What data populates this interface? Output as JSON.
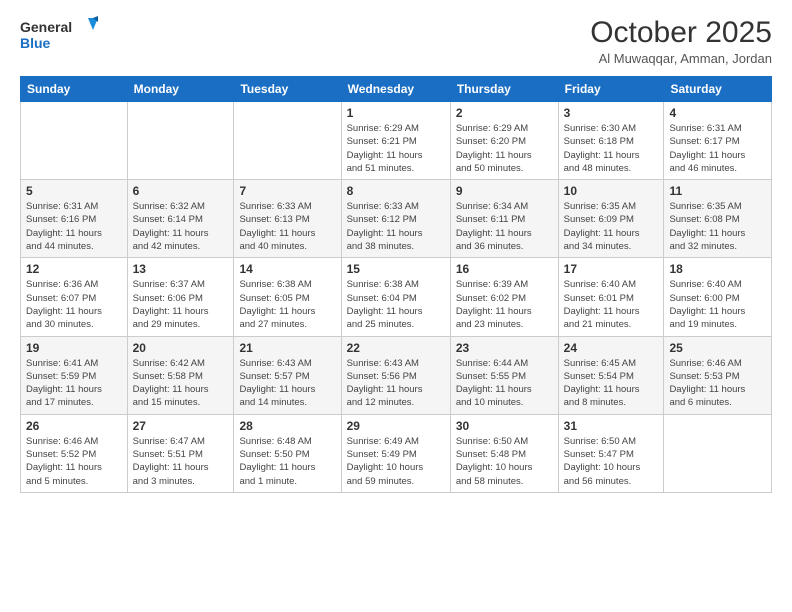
{
  "logo": {
    "line1": "General",
    "line2": "Blue"
  },
  "header": {
    "title": "October 2025",
    "subtitle": "Al Muwaqqar, Amman, Jordan"
  },
  "weekdays": [
    "Sunday",
    "Monday",
    "Tuesday",
    "Wednesday",
    "Thursday",
    "Friday",
    "Saturday"
  ],
  "weeks": [
    [
      {
        "day": "",
        "info": ""
      },
      {
        "day": "",
        "info": ""
      },
      {
        "day": "",
        "info": ""
      },
      {
        "day": "1",
        "info": "Sunrise: 6:29 AM\nSunset: 6:21 PM\nDaylight: 11 hours\nand 51 minutes."
      },
      {
        "day": "2",
        "info": "Sunrise: 6:29 AM\nSunset: 6:20 PM\nDaylight: 11 hours\nand 50 minutes."
      },
      {
        "day": "3",
        "info": "Sunrise: 6:30 AM\nSunset: 6:18 PM\nDaylight: 11 hours\nand 48 minutes."
      },
      {
        "day": "4",
        "info": "Sunrise: 6:31 AM\nSunset: 6:17 PM\nDaylight: 11 hours\nand 46 minutes."
      }
    ],
    [
      {
        "day": "5",
        "info": "Sunrise: 6:31 AM\nSunset: 6:16 PM\nDaylight: 11 hours\nand 44 minutes."
      },
      {
        "day": "6",
        "info": "Sunrise: 6:32 AM\nSunset: 6:14 PM\nDaylight: 11 hours\nand 42 minutes."
      },
      {
        "day": "7",
        "info": "Sunrise: 6:33 AM\nSunset: 6:13 PM\nDaylight: 11 hours\nand 40 minutes."
      },
      {
        "day": "8",
        "info": "Sunrise: 6:33 AM\nSunset: 6:12 PM\nDaylight: 11 hours\nand 38 minutes."
      },
      {
        "day": "9",
        "info": "Sunrise: 6:34 AM\nSunset: 6:11 PM\nDaylight: 11 hours\nand 36 minutes."
      },
      {
        "day": "10",
        "info": "Sunrise: 6:35 AM\nSunset: 6:09 PM\nDaylight: 11 hours\nand 34 minutes."
      },
      {
        "day": "11",
        "info": "Sunrise: 6:35 AM\nSunset: 6:08 PM\nDaylight: 11 hours\nand 32 minutes."
      }
    ],
    [
      {
        "day": "12",
        "info": "Sunrise: 6:36 AM\nSunset: 6:07 PM\nDaylight: 11 hours\nand 30 minutes."
      },
      {
        "day": "13",
        "info": "Sunrise: 6:37 AM\nSunset: 6:06 PM\nDaylight: 11 hours\nand 29 minutes."
      },
      {
        "day": "14",
        "info": "Sunrise: 6:38 AM\nSunset: 6:05 PM\nDaylight: 11 hours\nand 27 minutes."
      },
      {
        "day": "15",
        "info": "Sunrise: 6:38 AM\nSunset: 6:04 PM\nDaylight: 11 hours\nand 25 minutes."
      },
      {
        "day": "16",
        "info": "Sunrise: 6:39 AM\nSunset: 6:02 PM\nDaylight: 11 hours\nand 23 minutes."
      },
      {
        "day": "17",
        "info": "Sunrise: 6:40 AM\nSunset: 6:01 PM\nDaylight: 11 hours\nand 21 minutes."
      },
      {
        "day": "18",
        "info": "Sunrise: 6:40 AM\nSunset: 6:00 PM\nDaylight: 11 hours\nand 19 minutes."
      }
    ],
    [
      {
        "day": "19",
        "info": "Sunrise: 6:41 AM\nSunset: 5:59 PM\nDaylight: 11 hours\nand 17 minutes."
      },
      {
        "day": "20",
        "info": "Sunrise: 6:42 AM\nSunset: 5:58 PM\nDaylight: 11 hours\nand 15 minutes."
      },
      {
        "day": "21",
        "info": "Sunrise: 6:43 AM\nSunset: 5:57 PM\nDaylight: 11 hours\nand 14 minutes."
      },
      {
        "day": "22",
        "info": "Sunrise: 6:43 AM\nSunset: 5:56 PM\nDaylight: 11 hours\nand 12 minutes."
      },
      {
        "day": "23",
        "info": "Sunrise: 6:44 AM\nSunset: 5:55 PM\nDaylight: 11 hours\nand 10 minutes."
      },
      {
        "day": "24",
        "info": "Sunrise: 6:45 AM\nSunset: 5:54 PM\nDaylight: 11 hours\nand 8 minutes."
      },
      {
        "day": "25",
        "info": "Sunrise: 6:46 AM\nSunset: 5:53 PM\nDaylight: 11 hours\nand 6 minutes."
      }
    ],
    [
      {
        "day": "26",
        "info": "Sunrise: 6:46 AM\nSunset: 5:52 PM\nDaylight: 11 hours\nand 5 minutes."
      },
      {
        "day": "27",
        "info": "Sunrise: 6:47 AM\nSunset: 5:51 PM\nDaylight: 11 hours\nand 3 minutes."
      },
      {
        "day": "28",
        "info": "Sunrise: 6:48 AM\nSunset: 5:50 PM\nDaylight: 11 hours\nand 1 minute."
      },
      {
        "day": "29",
        "info": "Sunrise: 6:49 AM\nSunset: 5:49 PM\nDaylight: 10 hours\nand 59 minutes."
      },
      {
        "day": "30",
        "info": "Sunrise: 6:50 AM\nSunset: 5:48 PM\nDaylight: 10 hours\nand 58 minutes."
      },
      {
        "day": "31",
        "info": "Sunrise: 6:50 AM\nSunset: 5:47 PM\nDaylight: 10 hours\nand 56 minutes."
      },
      {
        "day": "",
        "info": ""
      }
    ]
  ]
}
